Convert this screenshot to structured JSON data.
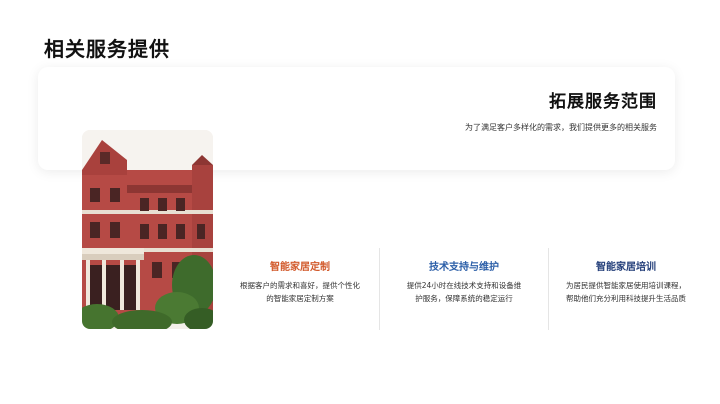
{
  "page": {
    "title": "相关服务提供"
  },
  "hero": {
    "title": "拓展服务范围",
    "subtitle": "为了满足客户多样化的需求，我们提供更多的相关服务"
  },
  "features": [
    {
      "title": "智能家居定制",
      "description": "根据客户的需求和喜好，提供个性化的智能家居定制方案",
      "color": "#d25a2c"
    },
    {
      "title": "技术支持与维护",
      "description": "提供24小时在线技术支持和设备维护服务，保障系统的稳定运行",
      "color": "#2c5fa8"
    },
    {
      "title": "智能家居培训",
      "description": "为居民提供智能家居使用培训课程，帮助他们充分利用科技提升生活品质",
      "color": "#243f7a"
    }
  ]
}
